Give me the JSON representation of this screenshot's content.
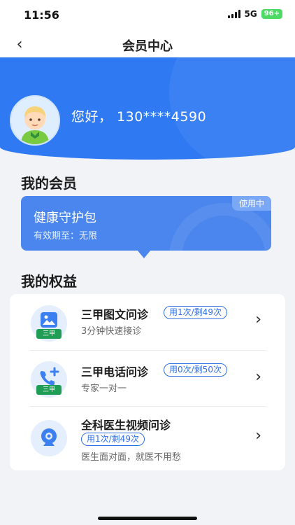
{
  "status_bar": {
    "time": "11:56",
    "network": "5G",
    "battery": "96+"
  },
  "nav": {
    "title": "会员中心",
    "back_icon": "chevron-left-icon"
  },
  "user": {
    "greeting": "您好， 130****4590"
  },
  "membership": {
    "section_title": "我的会员",
    "card": {
      "name": "健康守护包",
      "validity": "有效期至：无限",
      "status": "使用中"
    }
  },
  "benefits": {
    "section_title": "我的权益",
    "items": [
      {
        "title": "三甲图文问诊",
        "usage": "用1次/剩49次",
        "desc": "3分钟快速接诊",
        "icon": "image-consult-icon",
        "badge": "三甲"
      },
      {
        "title": "三甲电话问诊",
        "usage": "用0次/剩50次",
        "desc": "专家一对一",
        "icon": "phone-consult-icon",
        "badge": "三甲"
      },
      {
        "title": "全科医生视频问诊",
        "usage": "用1次/剩49次",
        "desc": "医生面对面，就医不用愁",
        "icon": "video-camera-icon"
      }
    ]
  },
  "colors": {
    "brand": "#2f7af3",
    "card": "#4a86ee",
    "pill": "#2f6fe6",
    "badge": "#1f9d55"
  }
}
